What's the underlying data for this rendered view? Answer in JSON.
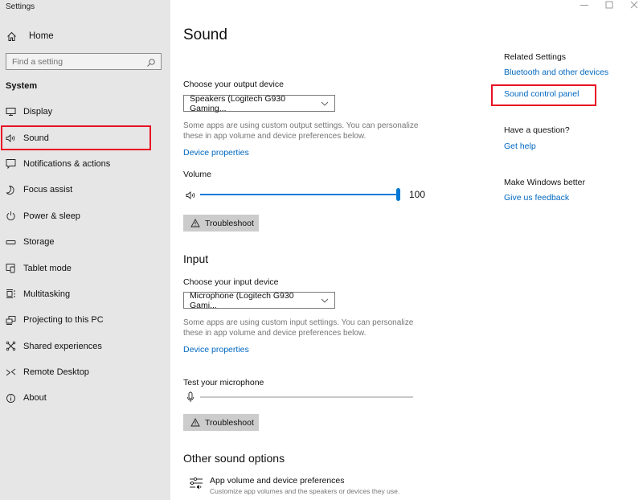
{
  "window": {
    "title": "Settings",
    "controls": {
      "minimize": "minimize-icon",
      "maximize": "maximize-icon",
      "close": "close-icon"
    }
  },
  "sidebar": {
    "home_label": "Home",
    "search": {
      "placeholder": "Find a setting",
      "value": ""
    },
    "section_title": "System",
    "items": [
      {
        "label": "Display",
        "icon": "display-icon",
        "active": false
      },
      {
        "label": "Sound",
        "icon": "speaker-icon",
        "active": true
      },
      {
        "label": "Notifications & actions",
        "icon": "notifications-icon",
        "active": false
      },
      {
        "label": "Focus assist",
        "icon": "moon-icon",
        "active": false
      },
      {
        "label": "Power & sleep",
        "icon": "power-icon",
        "active": false
      },
      {
        "label": "Storage",
        "icon": "storage-icon",
        "active": false
      },
      {
        "label": "Tablet mode",
        "icon": "tablet-mode-icon",
        "active": false
      },
      {
        "label": "Multitasking",
        "icon": "multitasking-icon",
        "active": false
      },
      {
        "label": "Projecting to this PC",
        "icon": "projecting-icon",
        "active": false
      },
      {
        "label": "Shared experiences",
        "icon": "shared-experiences-icon",
        "active": false
      },
      {
        "label": "Remote Desktop",
        "icon": "remote-desktop-icon",
        "active": false
      },
      {
        "label": "About",
        "icon": "info-icon",
        "active": false
      }
    ]
  },
  "main": {
    "title": "Sound",
    "output": {
      "label": "Choose your output device",
      "selected": "Speakers (Logitech G930 Gaming...",
      "desc": "Some apps are using custom output settings. You can personalize these in app volume and device preferences below.",
      "device_properties": "Device properties",
      "volume_label": "Volume",
      "volume_value": "100",
      "volume_percent": 100,
      "troubleshoot": "Troubleshoot"
    },
    "input": {
      "heading": "Input",
      "label": "Choose your input device",
      "selected": "Microphone (Logitech G930 Gami...",
      "desc": "Some apps are using custom input settings. You can personalize these in app volume and device preferences below.",
      "device_properties": "Device properties",
      "test_label": "Test your microphone",
      "mic_level_percent": 0,
      "troubleshoot": "Troubleshoot"
    },
    "other": {
      "heading": "Other sound options",
      "app_volume_title": "App volume and device preferences",
      "app_volume_sub": "Customize app volumes and the speakers or devices they use."
    }
  },
  "related": {
    "heading": "Related Settings",
    "links": [
      "Bluetooth and other devices",
      "Sound control panel"
    ],
    "question_heading": "Have a question?",
    "help_link": "Get help",
    "better_heading": "Make Windows better",
    "feedback_link": "Give us feedback"
  },
  "colors": {
    "accent": "#0078d7",
    "link": "#0067c0",
    "highlight": "#e81123",
    "sidebar_bg": "#e6e6e6"
  }
}
